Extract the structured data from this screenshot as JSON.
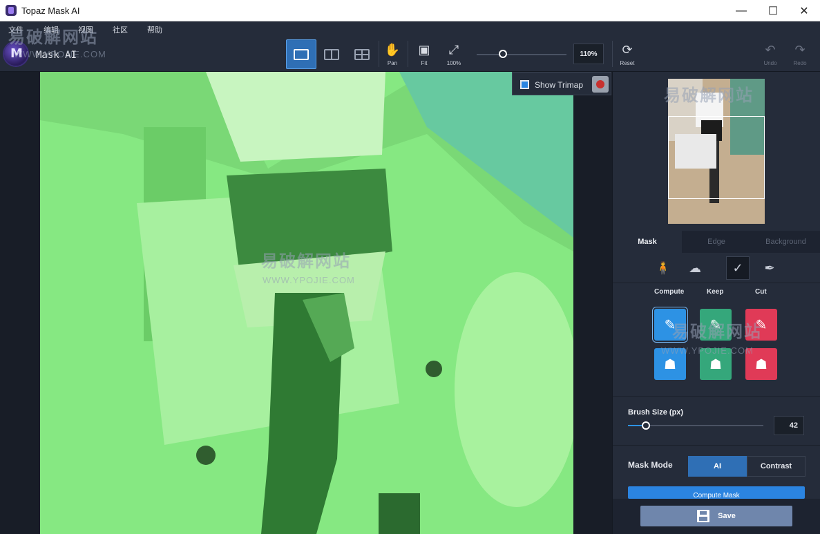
{
  "window": {
    "title": "Topaz Mask AI"
  },
  "menu": {
    "items": [
      "文件",
      "编辑",
      "视图",
      "社区",
      "帮助"
    ]
  },
  "app": {
    "name": "Mask AI",
    "logo_letter": "M"
  },
  "toolbar": {
    "pan_label": "Pan",
    "fit_label": "Fit",
    "zoom100_label": "100%",
    "zoom_value": "110%",
    "reset_label": "Reset",
    "undo_label": "Undo",
    "redo_label": "Redo"
  },
  "canvas": {
    "show_trimap_label": "Show Trimap"
  },
  "watermarks": {
    "text_cn": "易破解网站",
    "text_url": "WWW.YPOJIE.COM"
  },
  "panel": {
    "tabs": [
      "Mask",
      "Edge",
      "Background"
    ],
    "active_tab": "Mask",
    "column_labels": [
      "Compute",
      "Keep",
      "Cut"
    ],
    "brush_size_label": "Brush Size (px)",
    "brush_size_value": "42",
    "brush_size_fraction": 0.13,
    "mask_mode_label": "Mask Mode",
    "mask_mode_options": [
      "AI",
      "Contrast"
    ],
    "mask_mode_selected": "AI",
    "compute_button_label": "Compute Mask",
    "save_label": "Save"
  },
  "colors": {
    "accent": "#2f6fb5",
    "compute": "#2d92e4",
    "keep": "#35a77b",
    "cut": "#e03a57",
    "overlay_green": "#7fe37a"
  }
}
